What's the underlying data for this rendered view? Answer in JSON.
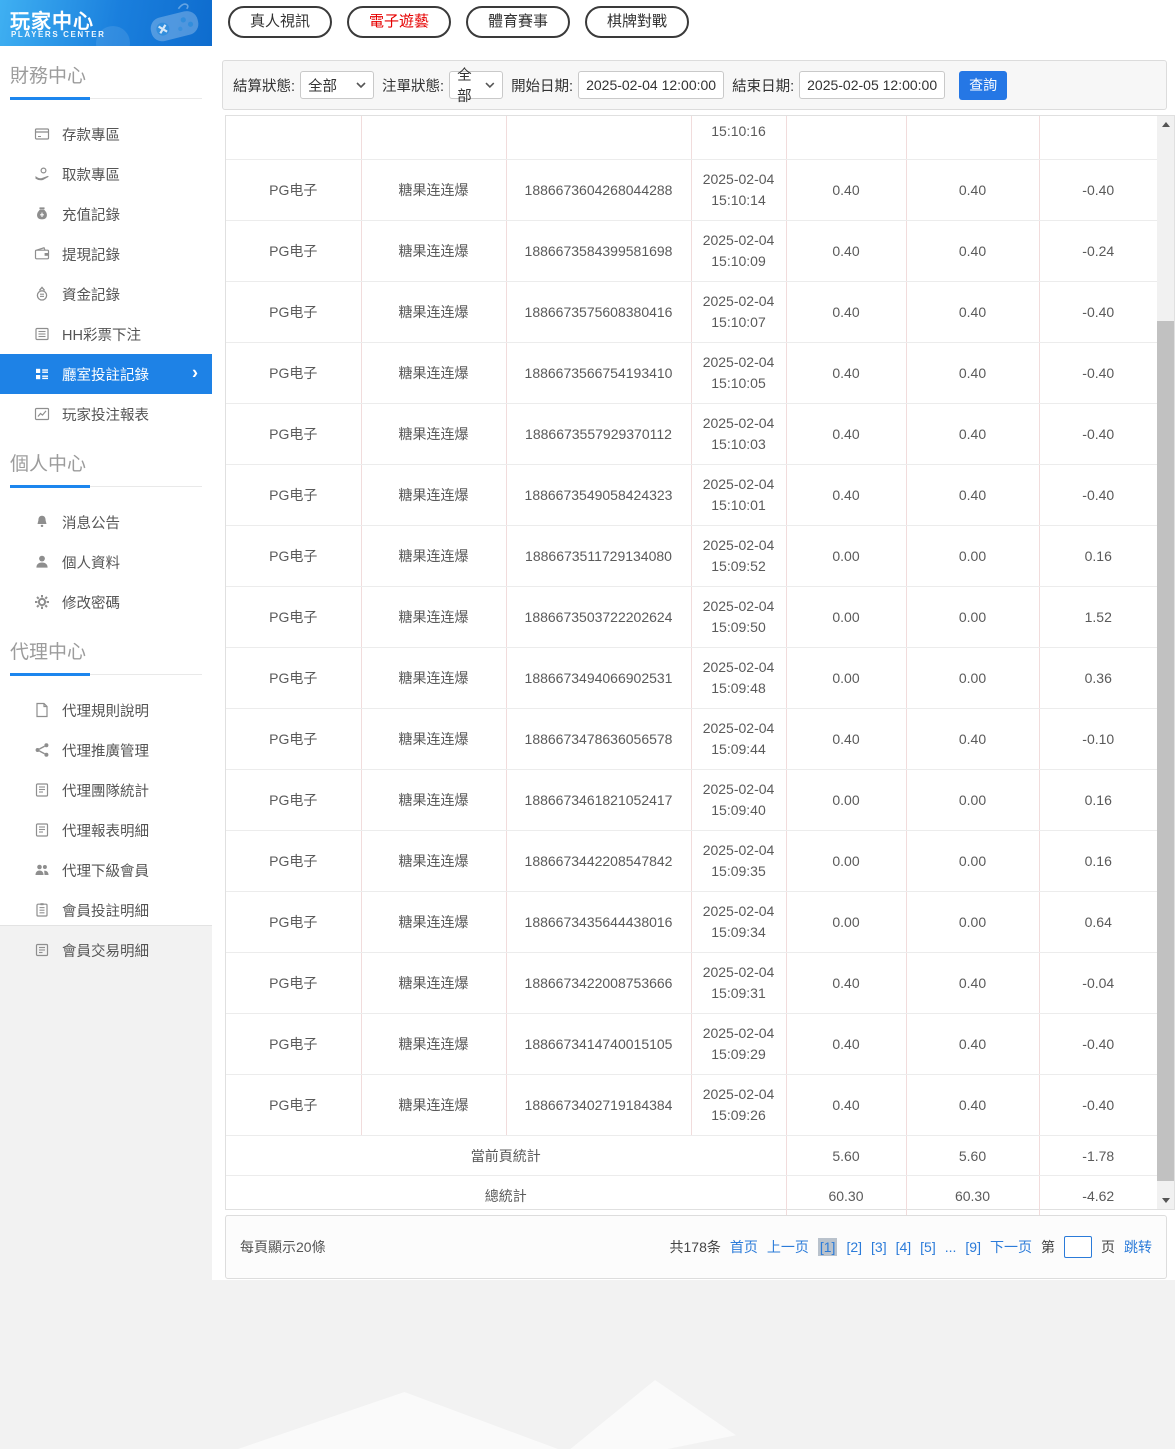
{
  "sidebar": {
    "title": "玩家中心",
    "subtitle": "PLAYERS CENTER",
    "sections": [
      {
        "title": "財務中心",
        "items": [
          {
            "label": "存款專區",
            "icon": "card"
          },
          {
            "label": "取款專區",
            "icon": "hand-coin"
          },
          {
            "label": "充值記錄",
            "icon": "moneybag"
          },
          {
            "label": "提現記錄",
            "icon": "wallet"
          },
          {
            "label": "資金記錄",
            "icon": "coin-doc"
          },
          {
            "label": "HH彩票下注",
            "icon": "list"
          },
          {
            "label": "廳室投註記錄",
            "icon": "grid-list",
            "active": true,
            "has_arrow": true
          },
          {
            "label": "玩家投注報表",
            "icon": "chart"
          }
        ]
      },
      {
        "title": "個人中心",
        "items": [
          {
            "label": "消息公告",
            "icon": "bell"
          },
          {
            "label": "個人資料",
            "icon": "user"
          },
          {
            "label": "修改密碼",
            "icon": "gear"
          }
        ]
      },
      {
        "title": "代理中心",
        "items": [
          {
            "label": "代理規則說明",
            "icon": "doc"
          },
          {
            "label": "代理推廣管理",
            "icon": "share"
          },
          {
            "label": "代理團隊統計",
            "icon": "report"
          },
          {
            "label": "代理報表明細",
            "icon": "report"
          },
          {
            "label": "代理下級會員",
            "icon": "users"
          },
          {
            "label": "會員投註明細",
            "icon": "note"
          },
          {
            "label": "會員交易明細",
            "icon": "note2"
          }
        ]
      }
    ]
  },
  "tabs": [
    {
      "label": "真人視訊",
      "active": false
    },
    {
      "label": "電子遊藝",
      "active": true
    },
    {
      "label": "體育賽事",
      "active": false
    },
    {
      "label": "棋牌對戰",
      "active": false
    }
  ],
  "filters": {
    "settle_status_label": "結算狀態:",
    "settle_status_value": "全部",
    "order_status_label": "注單狀態:",
    "order_status_value": "全部",
    "start_date_label": "開始日期:",
    "start_date_value": "2025-02-04 12:00:00",
    "end_date_label": "結束日期:",
    "end_date_value": "2025-02-05 12:00:00",
    "search_label": "查詢"
  },
  "table": {
    "partial_row_time": "15:10:16",
    "rows": [
      {
        "provider": "PG电子",
        "game": "糖果连连爆",
        "order": "1886673604268044288",
        "date": "2025-02-04",
        "time": "15:10:14",
        "bet": "0.40",
        "valid": "0.40",
        "profit": "-0.40"
      },
      {
        "provider": "PG电子",
        "game": "糖果连连爆",
        "order": "1886673584399581698",
        "date": "2025-02-04",
        "time": "15:10:09",
        "bet": "0.40",
        "valid": "0.40",
        "profit": "-0.24"
      },
      {
        "provider": "PG电子",
        "game": "糖果连连爆",
        "order": "1886673575608380416",
        "date": "2025-02-04",
        "time": "15:10:07",
        "bet": "0.40",
        "valid": "0.40",
        "profit": "-0.40"
      },
      {
        "provider": "PG电子",
        "game": "糖果连连爆",
        "order": "1886673566754193410",
        "date": "2025-02-04",
        "time": "15:10:05",
        "bet": "0.40",
        "valid": "0.40",
        "profit": "-0.40"
      },
      {
        "provider": "PG电子",
        "game": "糖果连连爆",
        "order": "1886673557929370112",
        "date": "2025-02-04",
        "time": "15:10:03",
        "bet": "0.40",
        "valid": "0.40",
        "profit": "-0.40"
      },
      {
        "provider": "PG电子",
        "game": "糖果连连爆",
        "order": "1886673549058424323",
        "date": "2025-02-04",
        "time": "15:10:01",
        "bet": "0.40",
        "valid": "0.40",
        "profit": "-0.40"
      },
      {
        "provider": "PG电子",
        "game": "糖果连连爆",
        "order": "1886673511729134080",
        "date": "2025-02-04",
        "time": "15:09:52",
        "bet": "0.00",
        "valid": "0.00",
        "profit": "0.16"
      },
      {
        "provider": "PG电子",
        "game": "糖果连连爆",
        "order": "1886673503722202624",
        "date": "2025-02-04",
        "time": "15:09:50",
        "bet": "0.00",
        "valid": "0.00",
        "profit": "1.52"
      },
      {
        "provider": "PG电子",
        "game": "糖果连连爆",
        "order": "1886673494066902531",
        "date": "2025-02-04",
        "time": "15:09:48",
        "bet": "0.00",
        "valid": "0.00",
        "profit": "0.36"
      },
      {
        "provider": "PG电子",
        "game": "糖果连连爆",
        "order": "1886673478636056578",
        "date": "2025-02-04",
        "time": "15:09:44",
        "bet": "0.40",
        "valid": "0.40",
        "profit": "-0.10"
      },
      {
        "provider": "PG电子",
        "game": "糖果连连爆",
        "order": "1886673461821052417",
        "date": "2025-02-04",
        "time": "15:09:40",
        "bet": "0.00",
        "valid": "0.00",
        "profit": "0.16"
      },
      {
        "provider": "PG电子",
        "game": "糖果连连爆",
        "order": "1886673442208547842",
        "date": "2025-02-04",
        "time": "15:09:35",
        "bet": "0.00",
        "valid": "0.00",
        "profit": "0.16"
      },
      {
        "provider": "PG电子",
        "game": "糖果连连爆",
        "order": "1886673435644438016",
        "date": "2025-02-04",
        "time": "15:09:34",
        "bet": "0.00",
        "valid": "0.00",
        "profit": "0.64"
      },
      {
        "provider": "PG电子",
        "game": "糖果连连爆",
        "order": "1886673422008753666",
        "date": "2025-02-04",
        "time": "15:09:31",
        "bet": "0.40",
        "valid": "0.40",
        "profit": "-0.04"
      },
      {
        "provider": "PG电子",
        "game": "糖果连连爆",
        "order": "1886673414740015105",
        "date": "2025-02-04",
        "time": "15:09:29",
        "bet": "0.40",
        "valid": "0.40",
        "profit": "-0.40"
      },
      {
        "provider": "PG电子",
        "game": "糖果连连爆",
        "order": "1886673402719184384",
        "date": "2025-02-04",
        "time": "15:09:26",
        "bet": "0.40",
        "valid": "0.40",
        "profit": "-0.40"
      }
    ],
    "page_summary": {
      "label": "當前頁統計",
      "bet": "5.60",
      "valid": "5.60",
      "profit": "-1.78"
    },
    "total_summary": {
      "label": "總統計",
      "bet": "60.30",
      "valid": "60.30",
      "profit": "-4.62"
    }
  },
  "pagination": {
    "page_size_text": "每頁顯示20條",
    "total_text": "共178条",
    "first_label": "首页",
    "prev_label": "上一页",
    "pages": [
      {
        "label": "[1]",
        "current": true
      },
      {
        "label": "[2]"
      },
      {
        "label": "[3]"
      },
      {
        "label": "[4]"
      },
      {
        "label": "[5]"
      },
      {
        "label": "...",
        "ellipsis": true
      },
      {
        "label": "[9]"
      }
    ],
    "next_label": "下一页",
    "goto_prefix": "第",
    "goto_suffix": "页",
    "goto_button": "跳转",
    "goto_value": ""
  },
  "colors": {
    "accent_blue": "#1e82e6",
    "tab_active_red": "#e60000",
    "link_blue": "#2b7bd9",
    "search_button_blue": "#2577e5",
    "table_border_vertical": "#f1dcdc",
    "table_border_horizontal": "#ececec",
    "current_page_bg": "#b9c2cc",
    "header_gradient_start": "#3fb0f2",
    "header_gradient_end": "#0e6cce"
  }
}
